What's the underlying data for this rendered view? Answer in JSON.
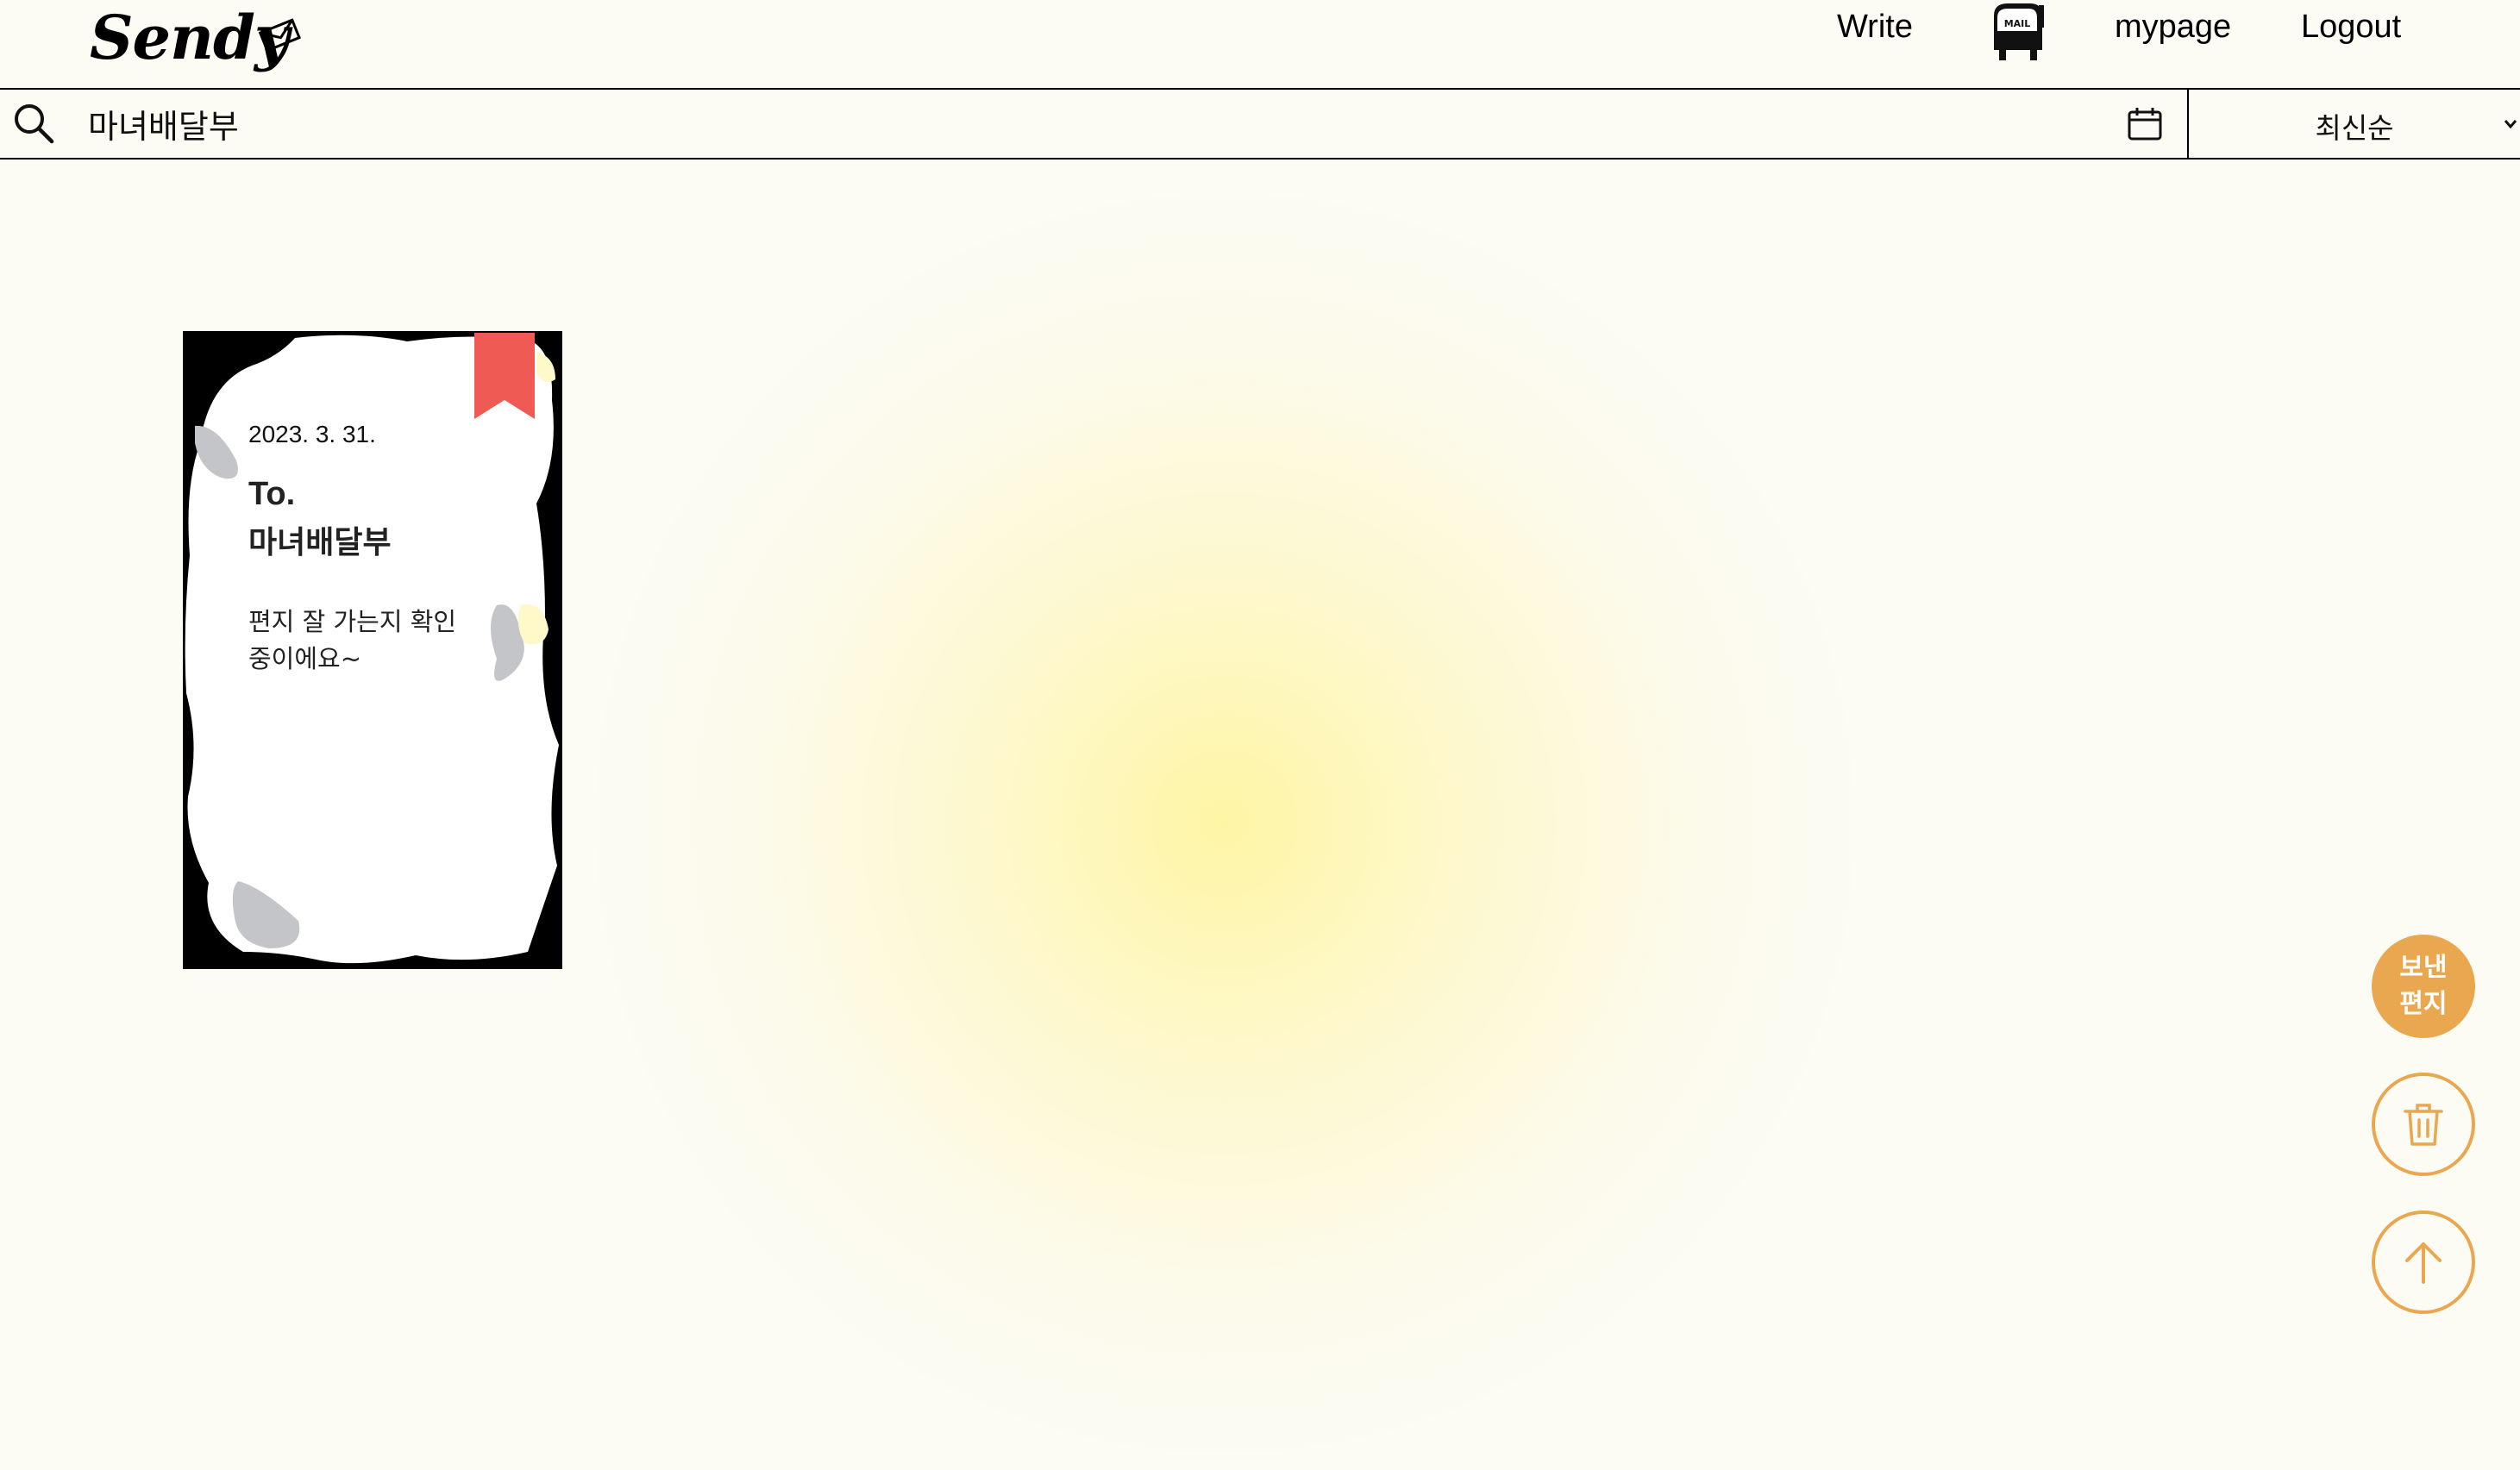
{
  "header": {
    "logo": "Sendy",
    "nav": {
      "write": "Write",
      "mailbox_label": "MAIL",
      "mypage": "mypage",
      "logout": "Logout"
    }
  },
  "search": {
    "value": "마녀배달부",
    "sort_selected": "최신순"
  },
  "letters": [
    {
      "date": "2023. 3. 31.",
      "to_label": "To.",
      "recipient": "마녀배달부",
      "body_line1": "편지 잘 가는지 확인",
      "body_line2": "중이에요~"
    }
  ],
  "fabs": {
    "sent_line1": "보낸",
    "sent_line2": "편지"
  },
  "colors": {
    "background": "#fcfbf4",
    "accent": "#e9a850",
    "bookmark": "#ef5a55",
    "glow": "#fff496"
  },
  "icons": [
    "envelope-icon",
    "mailbox-icon",
    "search-icon",
    "calendar-icon",
    "chevron-down-icon",
    "trash-icon",
    "arrow-up-icon"
  ]
}
